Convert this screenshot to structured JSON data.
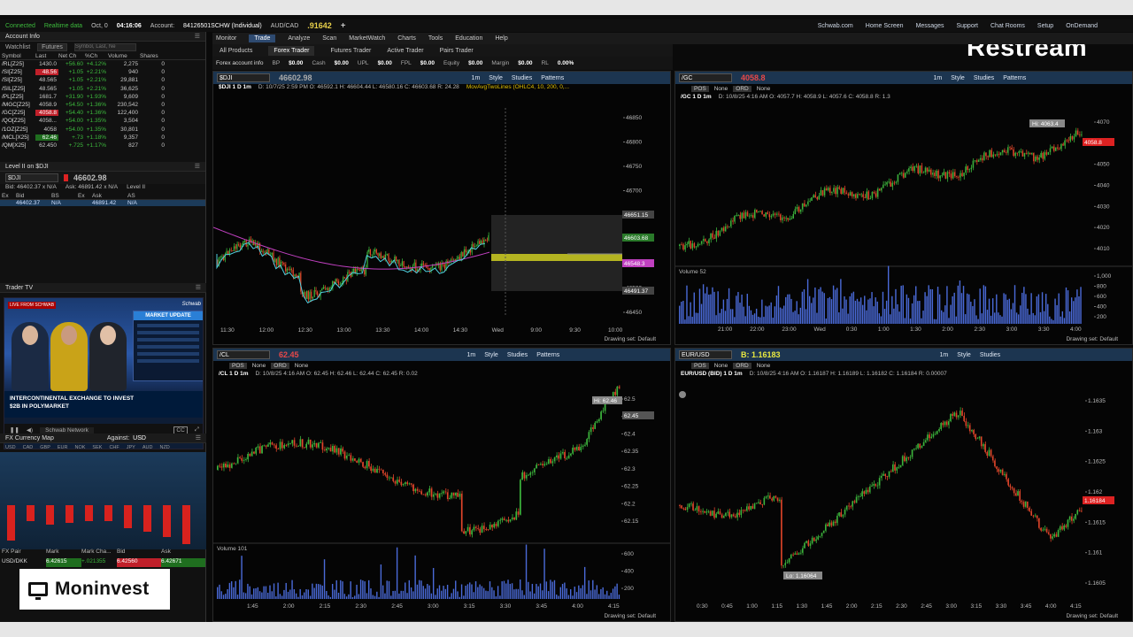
{
  "status": {
    "connected": "Connected",
    "realtime": "Realtime data",
    "date": "Oct, 0",
    "time": "04:16:06",
    "account_label": "Account:",
    "account": "84126501SCHW (Individual)",
    "pair": "AUD/CAD",
    "pair_price": ".91642",
    "links": [
      "Schwab.com",
      "Home Screen",
      "Messages",
      "Support",
      "Chat Rooms",
      "Setup",
      "OnDemand"
    ]
  },
  "watchlist": {
    "header": "Account Info",
    "title": "Watchlist",
    "dropdown": "Futures",
    "search_placeholder": "Symbol, Last, Ne",
    "columns": [
      "Symbol",
      "Last",
      "Net Ch",
      "%Ch",
      "Volume",
      "Shares"
    ],
    "rows": [
      [
        "/RL[Z25]",
        "1430.0",
        "+56.60",
        "+4.12%",
        "2,275",
        "0"
      ],
      [
        "/SI[Z25]",
        "48.56",
        "+1.05",
        "+2.21%",
        "940",
        "0"
      ],
      [
        "/SI[Z25]",
        "48.565",
        "+1.05",
        "+2.21%",
        "29,881",
        "0"
      ],
      [
        "/SIL[Z25]",
        "48.565",
        "+1.05",
        "+2.21%",
        "36,625",
        "0"
      ],
      [
        "/PL[Z25]",
        "1681.7",
        "+31.90",
        "+1.93%",
        "9,609",
        "0"
      ],
      [
        "/MGC[Z25]",
        "4058.9",
        "+54.50",
        "+1.36%",
        "230,542",
        "0"
      ],
      [
        "/GC[Z25]",
        "4058.8",
        "+54.40",
        "+1.36%",
        "122,400",
        "0"
      ],
      [
        "/QO[Z25]",
        "4058...",
        "+54.00",
        "+1.35%",
        "3,504",
        "0"
      ],
      [
        "/1OZ[Z25]",
        "4058",
        "+54.00",
        "+1.35%",
        "30,801",
        "0"
      ],
      [
        "/MCL[X25]",
        "62.46",
        "+.73",
        "+1.18%",
        "9,357",
        "0"
      ],
      [
        "/QM[X25]",
        "62.450",
        "+.725",
        "+1.17%",
        "827",
        "0"
      ]
    ]
  },
  "level2": {
    "header": "Level II on $DJI",
    "symbol": "$DJI",
    "price": "46602.98",
    "bid": "Bid: 46402.37 x N/A",
    "ask": "Ask: 46891.42 x N/A",
    "level": "Level II",
    "columns": [
      "Ex",
      "Bid",
      "BS",
      "Ex",
      "Ask",
      "AS",
      ""
    ],
    "row": [
      "",
      "46402.37",
      "N/A",
      "",
      "46891.42",
      "N/A",
      ""
    ]
  },
  "tv": {
    "header": "Trader TV",
    "tag": "LIVE FROM SCHWAB",
    "brand": "Schwab",
    "market_update": "MARKET UPDATE",
    "headline1": "INTERCONTINENTAL EXCHANGE TO INVEST",
    "headline2": "$2B IN POLYMARKET",
    "network": "Schwab Network"
  },
  "fxmap": {
    "header": "FX Currency Map",
    "against_label": "Against:",
    "against": "USD",
    "currencies": [
      "USD",
      "CAD",
      "GBP",
      "EUR",
      "NOK",
      "SEK",
      "CHF",
      "JPY",
      "AUD",
      "NZD"
    ],
    "table_cols": [
      "FX Pair",
      "Mark",
      "Mark Cha...",
      "Bid",
      "Ask"
    ],
    "row": [
      "USD/DKK",
      "6.42615",
      "+.021355",
      "6.42560",
      "6.42671"
    ]
  },
  "branding": {
    "restream": "Restream",
    "moninvest": "Moninvest"
  },
  "menu": {
    "tabs": [
      "Monitor",
      "Trade",
      "Analyze",
      "Scan",
      "MarketWatch",
      "Charts",
      "Tools",
      "Education",
      "Help"
    ],
    "active": "Trade",
    "sub": [
      "All Products",
      "Forex Trader",
      "Futures Trader",
      "Active Trader",
      "Pairs Trader"
    ],
    "sub_active": "Forex Trader",
    "account_info": "Forex account info",
    "acct": [
      [
        "BP",
        "$0.00"
      ],
      [
        "Cash",
        "$0.00"
      ],
      [
        "UPL",
        "$0.00"
      ],
      [
        "FPL",
        "$0.00"
      ],
      [
        "Equity",
        "$0.00"
      ],
      [
        "Margin",
        "$0.00"
      ],
      [
        "RL",
        "0.00%"
      ]
    ]
  },
  "charts": {
    "common": {
      "style": "Style",
      "studies": "Studies",
      "patterns": "Patterns",
      "timeframe": "1m",
      "none": "None",
      "drawing_set": "Drawing set: Default"
    },
    "dji": {
      "symbol": "$DJI",
      "price": "46602.98",
      "title": "$DJI 1 D 1m",
      "ohlc": "D: 10/7/25 2:59 PM  O: 46592.1  H: 46604.44  L: 46580.16  C: 46603.68  R: 24.28",
      "study": "MovAvgTwoLines (OHLC4, 10, 200, 0,...",
      "y_ticks": [
        "46850",
        "46800",
        "46750",
        "46700",
        "46650",
        "46600",
        "46550",
        "46500",
        "46450"
      ],
      "x_ticks": [
        "11:30",
        "12:00",
        "12:30",
        "13:00",
        "13:30",
        "14:00",
        "14:30",
        "Wed",
        "9:00",
        "9:30",
        "10:00"
      ],
      "labels": [
        "46651.15",
        "46603.68",
        "46548.3",
        "46491.37"
      ]
    },
    "gc": {
      "symbol": "/GC",
      "price": "4058.8",
      "title": "/GC 1 D 1m",
      "ohlc": "D: 10/8/25 4:16 AM  O: 4057.7  H: 4058.9  L: 4057.6  C: 4058.8  R: 1.3",
      "hi_label": "Hi: 4063.4",
      "last_label": "4058.8",
      "y_ticks": [
        "4070",
        "4060",
        "4050",
        "4040",
        "4030",
        "4020",
        "4010"
      ],
      "vol_ticks": [
        "1,000",
        "800",
        "600",
        "400",
        "200"
      ],
      "volume": "Volume",
      "vol_val": "52",
      "x_ticks": [
        "21:00",
        "22:00",
        "23:00",
        "Wed",
        "0:30",
        "1:00",
        "1:30",
        "2:00",
        "2:30",
        "3:00",
        "3:30",
        "4:00"
      ]
    },
    "cl": {
      "symbol": "/CL",
      "price": "62.45",
      "title": "/CL 1 D 1m",
      "ohlc": "D: 10/8/25 4:16 AM  O: 62.45  H: 62.46  L: 62.44  C: 62.45  R: 0.02",
      "hi_label": "Hi: 62.46",
      "last_label": "62.45",
      "y_ticks": [
        "62.5",
        "62.45",
        "62.4",
        "62.35",
        "62.3",
        "62.25",
        "62.2",
        "62.15"
      ],
      "vol_ticks": [
        "600",
        "400",
        "200"
      ],
      "volume": "Volume",
      "vol_val": "101",
      "x_ticks": [
        "1:45",
        "2:00",
        "2:15",
        "2:30",
        "2:45",
        "3:00",
        "3:15",
        "3:30",
        "3:45",
        "4:00",
        "4:15"
      ]
    },
    "eur": {
      "symbol": "EUR/USD",
      "price": "B: 1.16183",
      "title": "EUR/USD (BID) 1 D 1m",
      "ohlc": "D: 10/8/25 4:16 AM  O: 1.16187  H: 1.16189  L: 1.16182  C: 1.16184  R: 0.00007",
      "lo_label": "Lo: 1.16064",
      "last_label": "1.16184",
      "y_ticks": [
        "1.1635",
        "1.163",
        "1.1625",
        "1.162",
        "1.1615",
        "1.161",
        "1.1605"
      ],
      "x_ticks": [
        "0:30",
        "0:45",
        "1:00",
        "1:15",
        "1:30",
        "1:45",
        "2:00",
        "2:15",
        "2:30",
        "2:45",
        "3:00",
        "3:15",
        "3:30",
        "3:45",
        "4:00",
        "4:15"
      ]
    }
  }
}
